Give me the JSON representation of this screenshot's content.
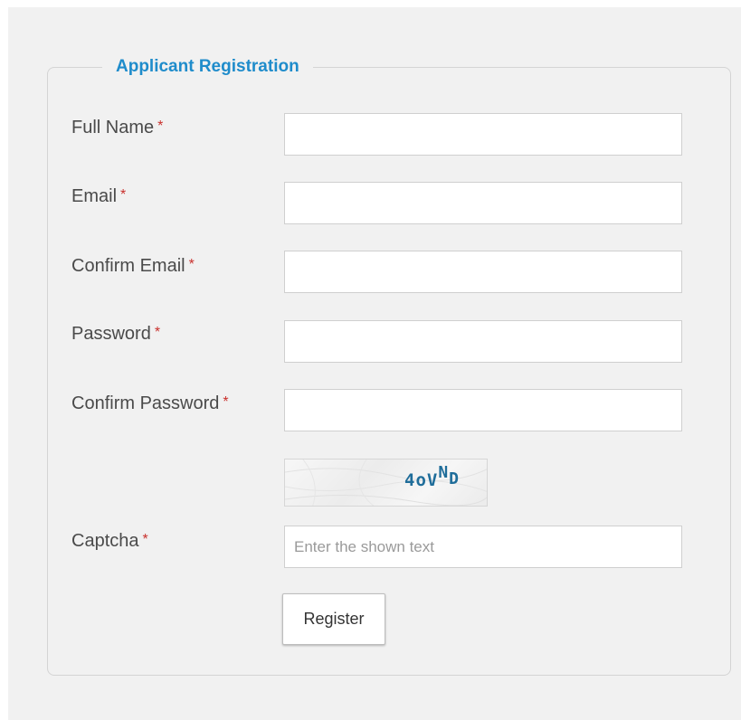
{
  "form": {
    "legend": "Applicant Registration",
    "required_marker": "*",
    "fields": {
      "full_name": {
        "label": "Full Name",
        "value": ""
      },
      "email": {
        "label": "Email",
        "value": ""
      },
      "confirm_email": {
        "label": "Confirm Email",
        "value": ""
      },
      "password": {
        "label": "Password",
        "value": ""
      },
      "confirm_password": {
        "label": "Confirm Password",
        "value": ""
      },
      "captcha": {
        "label": "Captcha",
        "value": "",
        "placeholder": "Enter the shown text"
      }
    },
    "captcha_image": {
      "text_main": "4oV",
      "text_sup": "N",
      "text_sub": "D",
      "text_color": "#1f6d9a"
    },
    "register_label": "Register"
  },
  "colors": {
    "legend": "#1f8ccb",
    "required": "#c9302c",
    "background": "#f1f1f1"
  }
}
